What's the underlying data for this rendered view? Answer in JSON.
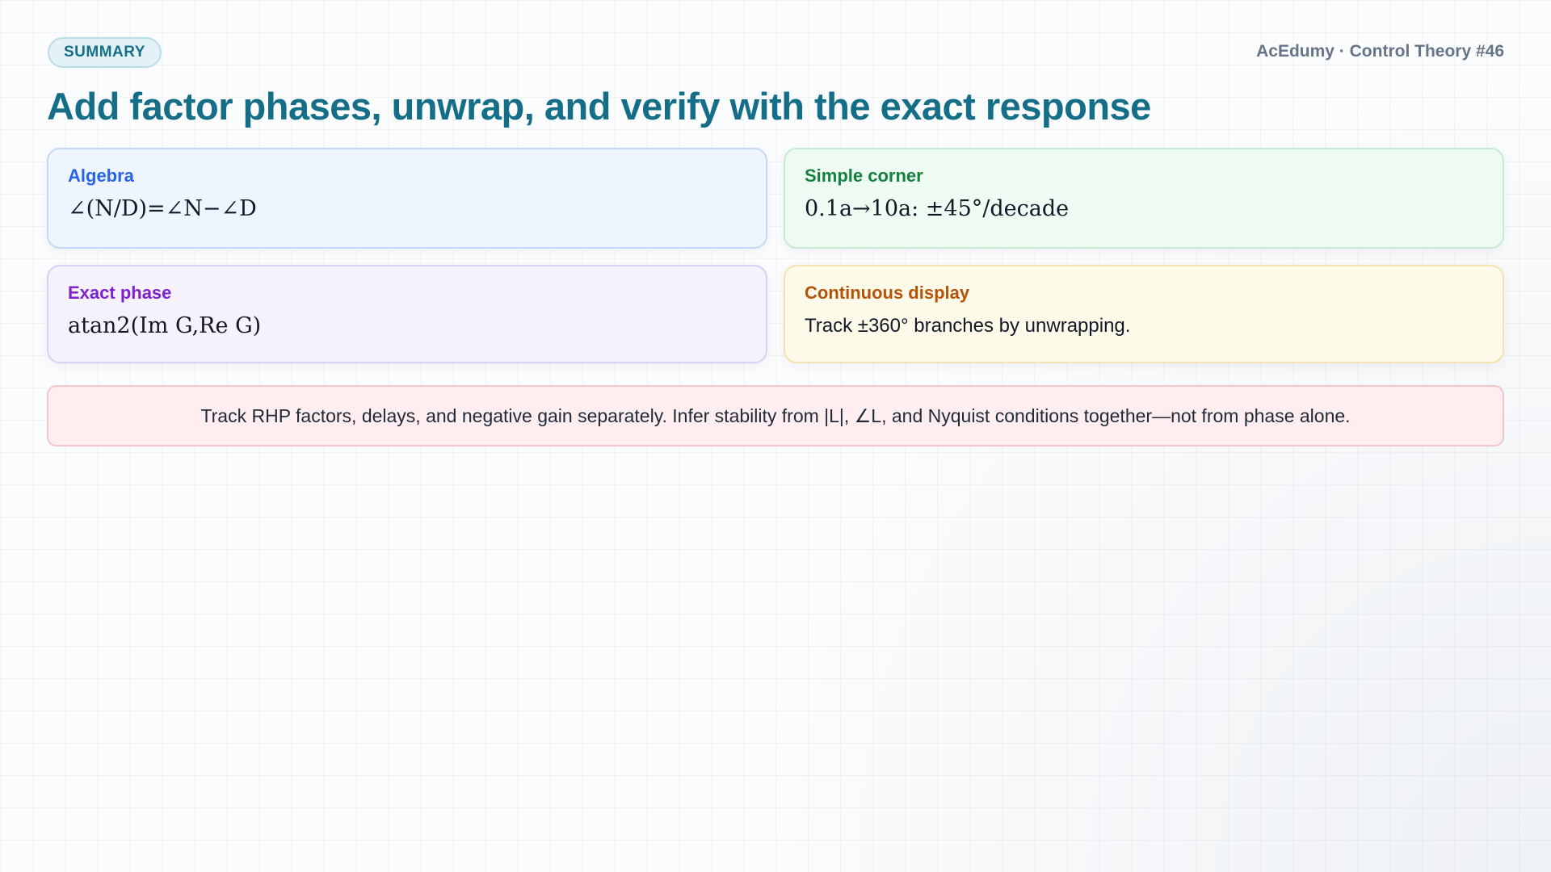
{
  "header": {
    "badge": "SUMMARY",
    "brand": "AcEdumy · Control Theory #46",
    "title": "Add factor phases, unwrap, and verify with the exact response"
  },
  "cards": [
    {
      "heading": "Algebra",
      "body": "∠(N/D)=∠N−∠D",
      "accent": "#2563eb",
      "background": "#eef5fe"
    },
    {
      "heading": "Simple corner",
      "body": "0.1a→10a: ±45°/decade",
      "accent": "#15803d",
      "background": "#eefbf2"
    },
    {
      "heading": "Exact phase",
      "body": "atan2(Im G,Re G)",
      "accent": "#7e22ce",
      "background": "#f5f2fe"
    },
    {
      "heading": "Continuous display",
      "body": "Track ±360° branches by unwrapping.",
      "accent": "#b45309",
      "background": "#fefaea"
    }
  ],
  "note": {
    "text": "Track RHP factors, delays, and negative gain separately. Infer stability from |L|, ∠L, and Nyquist conditions together—not from phase alone.",
    "background": "#feeef0"
  },
  "colors": {
    "title": "#146e87",
    "brand": "#667487"
  }
}
